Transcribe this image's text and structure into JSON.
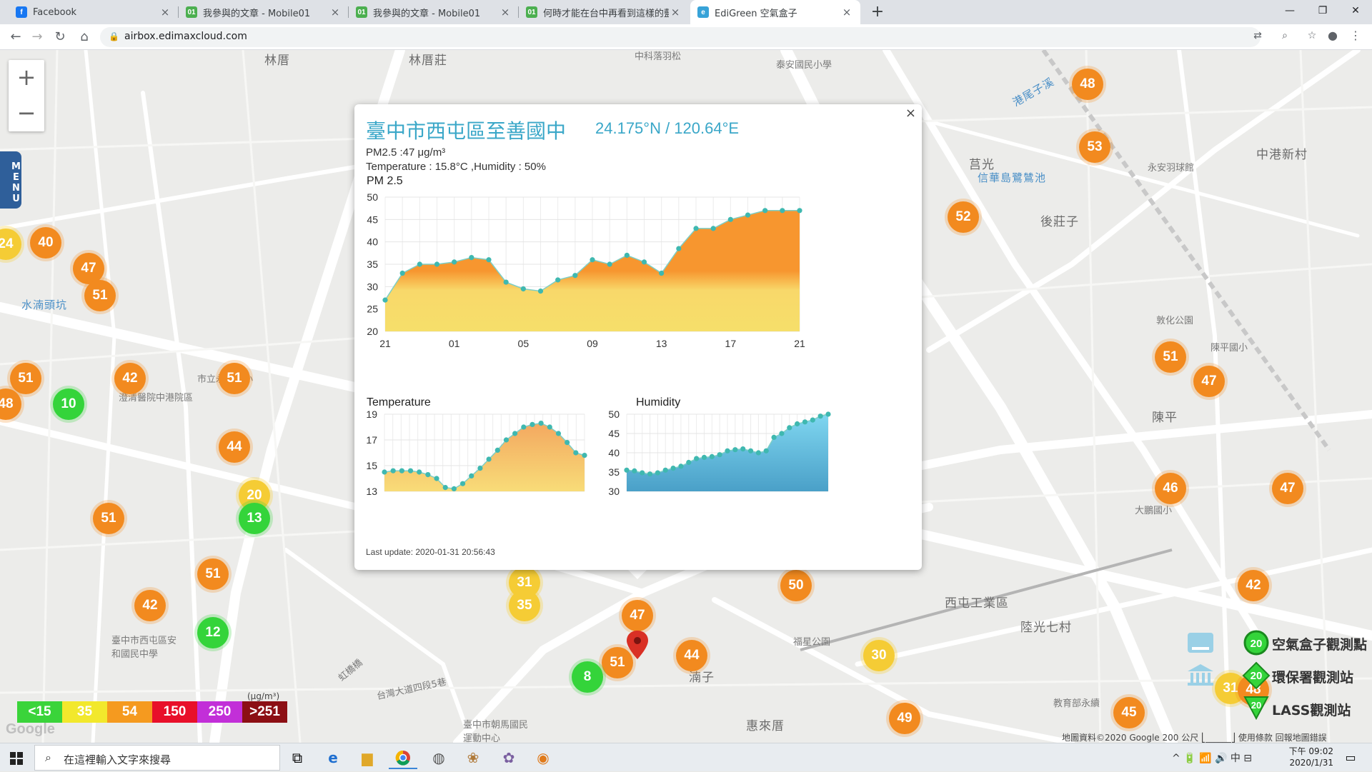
{
  "browser": {
    "tabs": [
      {
        "title": "Facebook",
        "icon": "facebook-icon",
        "color": "#1877f2",
        "glyph": "f"
      },
      {
        "title": "我參與的文章 - Mobile01",
        "icon": "mobile01-icon",
        "color": "#4caf50",
        "glyph": "01"
      },
      {
        "title": "我參與的文章 - Mobile01",
        "icon": "mobile01-icon",
        "color": "#4caf50",
        "glyph": "01"
      },
      {
        "title": "何時才能在台中再看到這樣的藍天",
        "icon": "mobile01-icon",
        "color": "#4caf50",
        "glyph": "01"
      },
      {
        "title": "EdiGreen 空氣盒子",
        "icon": "edigreen-icon",
        "color": "#38a3d8",
        "glyph": "e"
      }
    ],
    "url": "airbox.edimaxcloud.com"
  },
  "popup": {
    "site_name": "臺中市西屯區至善國中",
    "coords": "24.175°N / 120.64°E",
    "pm_line": "PM2.5 :47 μg/m³",
    "temp_line": "Temperature : 15.8°C ,Humidity : 50%",
    "chart_title": "PM 2.5",
    "temp_title": "Temperature",
    "hum_title": "Humidity",
    "last_update": "Last update: 2020-01-31 20:56:43"
  },
  "chart_data": [
    {
      "type": "area",
      "title": "PM 2.5",
      "x_ticks": [
        "21",
        "01",
        "05",
        "09",
        "13",
        "17",
        "21"
      ],
      "ylim": [
        20,
        50
      ],
      "y_ticks": [
        20,
        25,
        30,
        35,
        40,
        45,
        50
      ],
      "series": [
        {
          "values": [
            27,
            33,
            35,
            35,
            35.5,
            36.5,
            36,
            31,
            29.5,
            29,
            31.5,
            32.5,
            36,
            35,
            37,
            35.5,
            33,
            38.5,
            43,
            43,
            45,
            46,
            47,
            47,
            47
          ]
        }
      ]
    },
    {
      "type": "area",
      "title": "Temperature",
      "ylim": [
        13,
        19
      ],
      "y_ticks": [
        13,
        15,
        17,
        19
      ],
      "series": [
        {
          "values": [
            14.5,
            14.6,
            14.6,
            14.6,
            14.5,
            14.3,
            14,
            13.3,
            13.2,
            13.6,
            14.2,
            14.8,
            15.5,
            16.2,
            17,
            17.5,
            18,
            18.2,
            18.3,
            18,
            17.5,
            16.8,
            16,
            15.8
          ]
        }
      ]
    },
    {
      "type": "area",
      "title": "Humidity",
      "ylim": [
        30,
        50
      ],
      "y_ticks": [
        30,
        35,
        40,
        45,
        50
      ],
      "series": [
        {
          "values": [
            35.5,
            35.3,
            34.8,
            34.5,
            34.8,
            35.5,
            36,
            36.5,
            37.5,
            38.5,
            38.8,
            39,
            39.5,
            40.5,
            40.8,
            41,
            40.5,
            40,
            40.5,
            44,
            45,
            46.5,
            47.5,
            48,
            48.5,
            49.5,
            50
          ]
        }
      ]
    }
  ],
  "map": {
    "labels": [
      {
        "text": "林厝"
      },
      {
        "text": "林厝莊"
      },
      {
        "text": "中科落羽松"
      },
      {
        "text": "泰安國民小學"
      },
      {
        "text": "港尾子溪"
      },
      {
        "text": "中港新村"
      },
      {
        "text": "莒光"
      },
      {
        "text": "永安羽球館"
      },
      {
        "text": "後莊子"
      },
      {
        "text": "信華島鷺鷥池"
      },
      {
        "text": "水湳頭坑"
      },
      {
        "text": "敦化公園"
      },
      {
        "text": "陳平國小"
      },
      {
        "text": "陳平"
      },
      {
        "text": "澄清醫院中港院區"
      },
      {
        "text": "市立永安國小"
      },
      {
        "text": "西屯工業區"
      },
      {
        "text": "陸光七村"
      },
      {
        "text": "福星公園"
      },
      {
        "text": "臺中市西屯區安和國民中學"
      },
      {
        "text": "臺中市朝馬國民運動中心"
      },
      {
        "text": "惠來厝"
      },
      {
        "text": "湳子"
      },
      {
        "text": "教育部永續"
      },
      {
        "text": "大鵬國小"
      },
      {
        "text": "台灣大道四段5巷"
      },
      {
        "text": "虹橋橋"
      }
    ],
    "markers": [
      {
        "v": "48",
        "c": "o"
      },
      {
        "v": "53",
        "c": "o"
      },
      {
        "v": "52",
        "c": "o"
      },
      {
        "v": "40",
        "c": "o"
      },
      {
        "v": "24",
        "c": "y"
      },
      {
        "v": "47",
        "c": "o"
      },
      {
        "v": "51",
        "c": "o"
      },
      {
        "v": "51",
        "c": "o"
      },
      {
        "v": "42",
        "c": "o"
      },
      {
        "v": "51",
        "c": "o"
      },
      {
        "v": "48",
        "c": "o"
      },
      {
        "v": "10",
        "c": "g"
      },
      {
        "v": "44",
        "c": "o"
      },
      {
        "v": "20",
        "c": "y"
      },
      {
        "v": "13",
        "c": "g"
      },
      {
        "v": "51",
        "c": "o"
      },
      {
        "v": "51",
        "c": "o"
      },
      {
        "v": "42",
        "c": "o"
      },
      {
        "v": "12",
        "c": "g"
      },
      {
        "v": "31",
        "c": "y"
      },
      {
        "v": "35",
        "c": "y"
      },
      {
        "v": "47",
        "c": "o"
      },
      {
        "v": "51",
        "c": "o"
      },
      {
        "v": "8",
        "c": "g"
      },
      {
        "v": "44",
        "c": "o"
      },
      {
        "v": "50",
        "c": "o"
      },
      {
        "v": "30",
        "c": "y"
      },
      {
        "v": "49",
        "c": "o"
      },
      {
        "v": "51",
        "c": "o"
      },
      {
        "v": "47",
        "c": "o"
      },
      {
        "v": "46",
        "c": "o"
      },
      {
        "v": "47",
        "c": "o"
      },
      {
        "v": "42",
        "c": "o"
      },
      {
        "v": "45",
        "c": "o"
      },
      {
        "v": "31",
        "c": "y"
      },
      {
        "v": "48",
        "c": "o"
      }
    ],
    "zoom_in": "+",
    "zoom_out": "−",
    "menu_label": "MENU",
    "legend": [
      {
        "label": "<15",
        "color": "#3ad43a"
      },
      {
        "label": "35",
        "color": "#f2e82c"
      },
      {
        "label": "54",
        "color": "#f59a1f"
      },
      {
        "label": "150",
        "color": "#e8102a"
      },
      {
        "label": "250",
        "color": "#c22fd8"
      },
      {
        "label": ">251",
        "color": "#8c0f14"
      }
    ],
    "legend_unit": "(μg/m³)",
    "station_legend": {
      "airbox": "空氣盒子觀測點",
      "epa": "環保署觀測站",
      "lass": "LASS觀測站",
      "sample": "20"
    },
    "footer": "地圖資料©2020 Google   200 公尺 ⎣______⎦   使用條款   回報地圖錯誤",
    "google_logo": "Google"
  },
  "taskbar": {
    "search_placeholder": "在這裡輸入文字來搜尋",
    "tray": "^ 🔋 📶 🔊 中 ⊟",
    "time": "下午 09:02",
    "date": "2020/1/31"
  }
}
